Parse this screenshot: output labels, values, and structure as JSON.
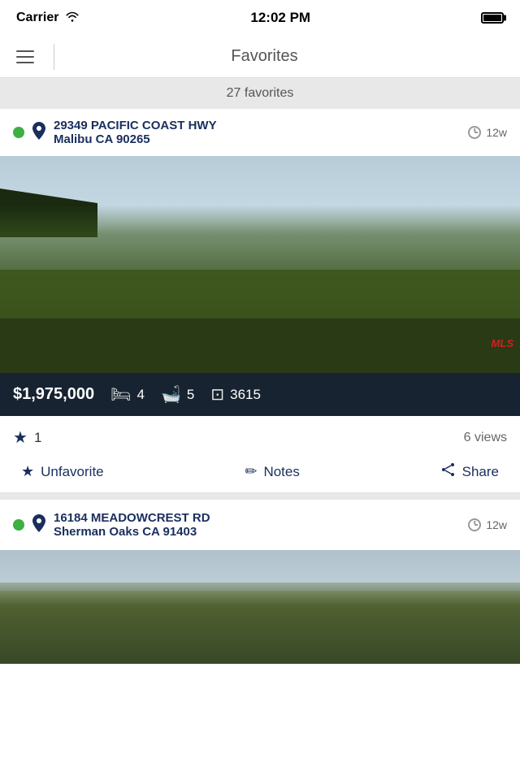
{
  "statusBar": {
    "carrier": "Carrier",
    "time": "12:02 PM",
    "wifi": "wifi-icon",
    "battery": "battery-icon"
  },
  "navBar": {
    "menuIcon": "hamburger-icon",
    "title": "Favorites"
  },
  "countBar": {
    "label": "27 favorites"
  },
  "listings": [
    {
      "id": "listing-1",
      "statusDot": "active",
      "addressLine1": "29349 PACIFIC COAST HWY",
      "addressLine2": "Malibu CA 90265",
      "timeAgo": "12w",
      "price": "$1,975,000",
      "beds": "4",
      "baths": "5",
      "sqft": "3615",
      "favoriteCount": "1",
      "views": "6 views",
      "actions": {
        "unfavorite": "Unfavorite",
        "notes": "Notes",
        "share": "Share"
      }
    },
    {
      "id": "listing-2",
      "statusDot": "active",
      "addressLine1": "16184 MEADOWCREST RD",
      "addressLine2": "Sherman Oaks CA 91403",
      "timeAgo": "12w"
    }
  ]
}
